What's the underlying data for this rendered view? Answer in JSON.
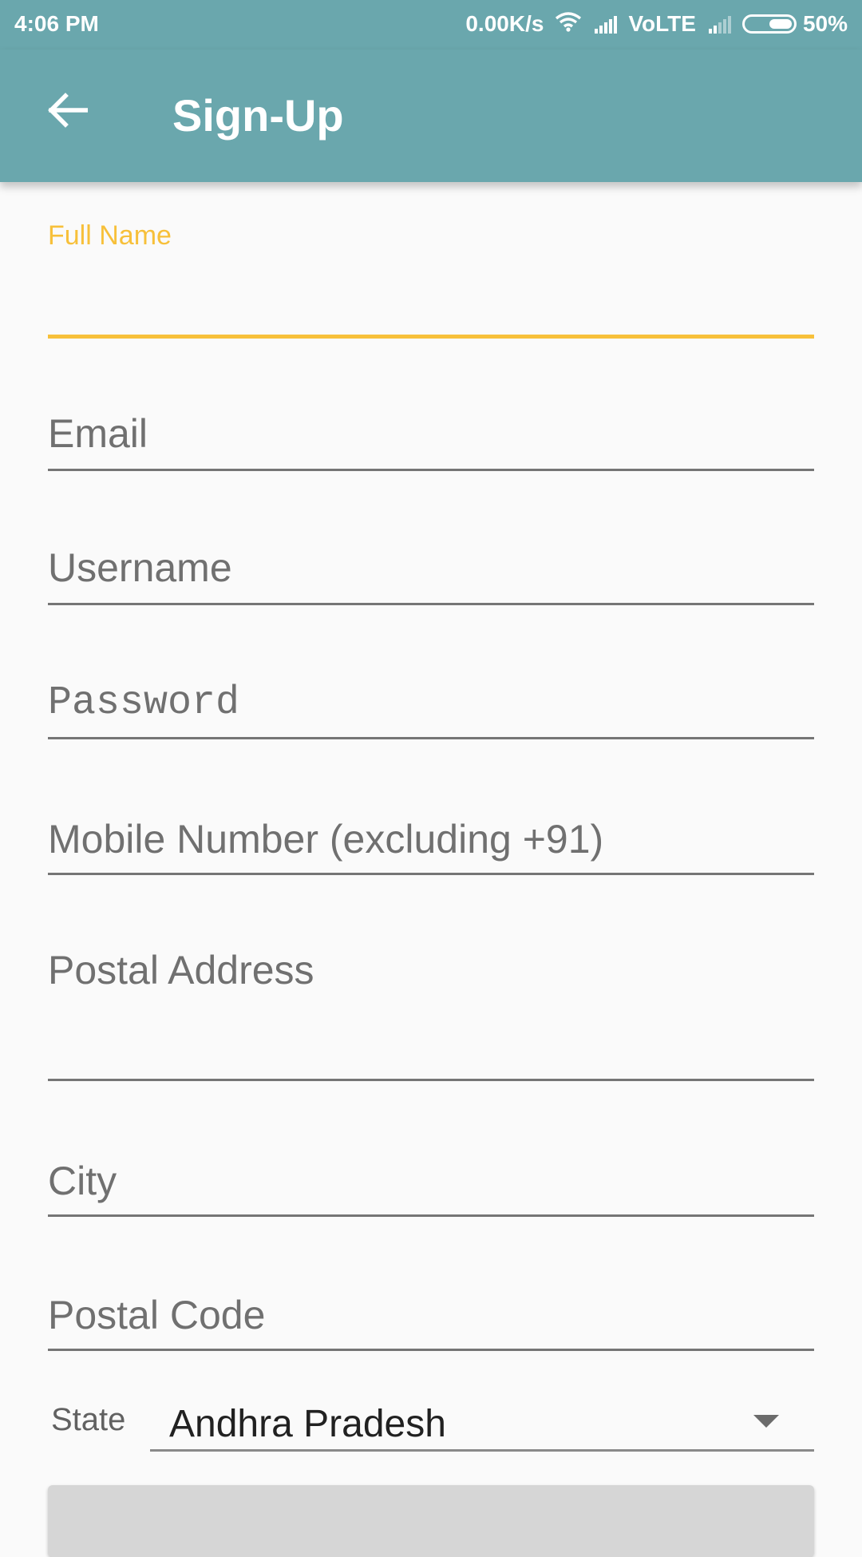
{
  "status_bar": {
    "time": "4:06 PM",
    "net_speed": "0.00K/s",
    "network_label": "VoLTE",
    "battery_percent_text": "50%",
    "battery_level": 0.5,
    "icons": [
      "wifi-icon",
      "signal-icon",
      "signal-weak-icon",
      "battery-icon"
    ]
  },
  "app_bar": {
    "title": "Sign-Up",
    "back_icon": "arrow-back-icon",
    "background_color": "#6aa7ad"
  },
  "form": {
    "full_name": {
      "label": "Full Name",
      "value": ""
    },
    "email": {
      "placeholder": "Email"
    },
    "username": {
      "placeholder": "Username"
    },
    "password": {
      "placeholder": "Password"
    },
    "mobile": {
      "placeholder": "Mobile Number (excluding +91)"
    },
    "postal_address": {
      "placeholder": "Postal Address"
    },
    "city": {
      "placeholder": "City"
    },
    "postal_code": {
      "placeholder": "Postal Code"
    },
    "state": {
      "label": "State",
      "selected": "Andhra Pradesh"
    }
  },
  "colors": {
    "accent": "#f7c03a",
    "primary": "#6aa7ad",
    "hint_text": "#707070"
  }
}
